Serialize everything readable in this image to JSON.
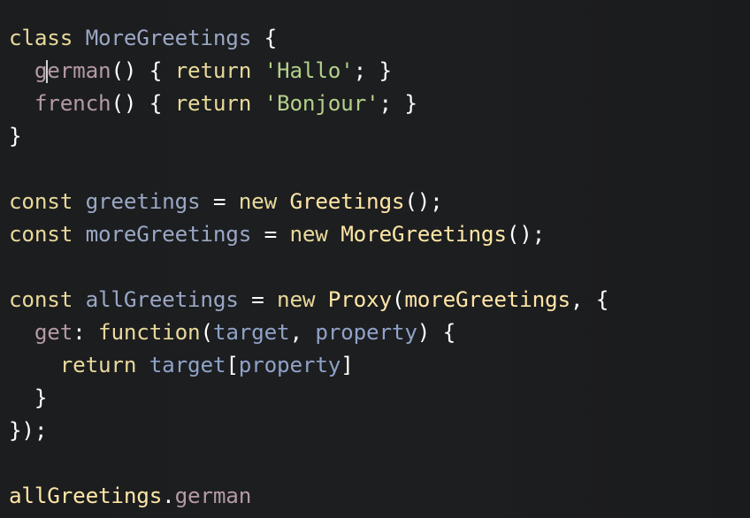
{
  "code": {
    "l1": {
      "a": "class",
      "b": " ",
      "c": "MoreGreetings",
      "d": " {"
    },
    "l2": {
      "indent": "  ",
      "a": "g",
      "b": "erman",
      "c": "()",
      "d": " { ",
      "e": "return",
      "f": " ",
      "g": "'Hallo'",
      "h": "; }"
    },
    "l3": {
      "indent": "  ",
      "a": "french",
      "b": "()",
      "c": " { ",
      "d": "return",
      "e": " ",
      "f": "'Bonjour'",
      "g": "; }"
    },
    "l4": {
      "a": "}"
    },
    "l6": {
      "a": "const",
      "b": " ",
      "c": "greetings",
      "d": " = ",
      "e": "new",
      "f": " ",
      "g": "Greetings",
      "h": "();"
    },
    "l7": {
      "a": "const",
      "b": " ",
      "c": "moreGreetings",
      "d": " = ",
      "e": "new",
      "f": " ",
      "g": "MoreGreetings",
      "h": "();"
    },
    "l9": {
      "a": "const",
      "b": " ",
      "c": "allGreetings",
      "d": " = ",
      "e": "new",
      "f": " ",
      "g": "Proxy",
      "h": "(",
      "i": "moreGreetings",
      "j": ", {"
    },
    "l10": {
      "indent": "  ",
      "a": "get",
      "b": ": ",
      "c": "function",
      "d": "(",
      "e": "target",
      "f": ", ",
      "g": "property",
      "h": ") {"
    },
    "l11": {
      "indent": "    ",
      "a": "return",
      "b": " ",
      "c": "target",
      "d": "[",
      "e": "property",
      "f": "]"
    },
    "l12": {
      "indent": "  ",
      "a": "}"
    },
    "l13": {
      "a": "});"
    },
    "l15": {
      "a": "allGreetings",
      "b": ".",
      "c": "german"
    }
  },
  "colors": {
    "background": "#1c1d1f",
    "keyword": "#e8d99a",
    "identifier": "#9aa7c4",
    "method": "#b49aa3",
    "string": "#b3d08a"
  }
}
